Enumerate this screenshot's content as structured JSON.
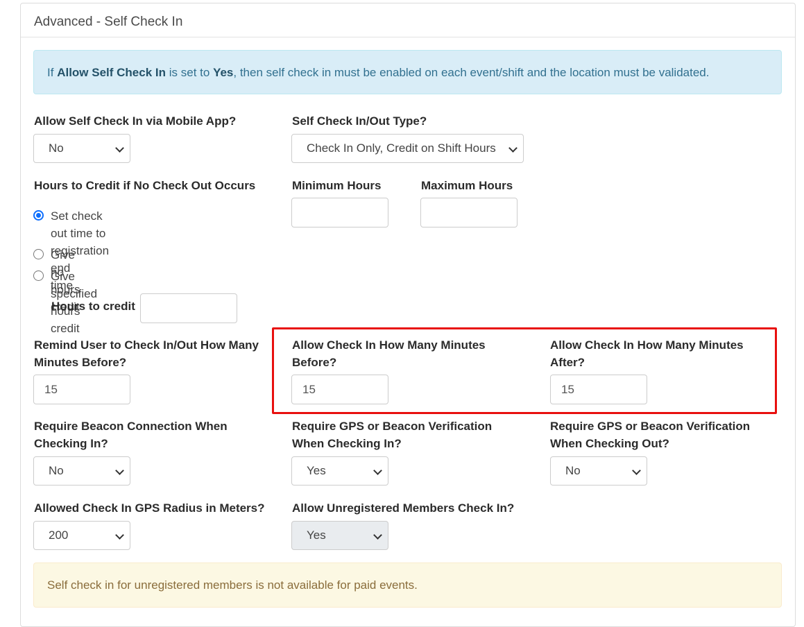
{
  "panel": {
    "title": "Advanced - Self Check In"
  },
  "info_alert": {
    "prefix": "If",
    "bold1": "Allow Self Check In",
    "mid": "is set to",
    "bold2": "Yes",
    "suffix": ", then self check in must be enabled on each event/shift and the location must be validated."
  },
  "mobile_app": {
    "label": "Allow Self Check In via Mobile App?",
    "value": "No"
  },
  "checkin_type": {
    "label": "Self Check In/Out Type?",
    "value": "Check In Only, Credit on Shift Hours"
  },
  "hours_credit": {
    "label": "Hours to Credit if No Check Out Occurs",
    "options": [
      {
        "label_line1": "Set check out time to registration end",
        "label_line2": "time",
        "checked": true
      },
      {
        "label": "Give no hours credit",
        "checked": false
      },
      {
        "label": "Give specified hours credit",
        "checked": false
      }
    ],
    "hours_to_credit_label": "Hours to credit",
    "hours_to_credit_value": ""
  },
  "min_hours": {
    "label": "Minimum Hours",
    "value": ""
  },
  "max_hours": {
    "label": "Maximum Hours",
    "value": ""
  },
  "remind": {
    "label_line1": "Remind User to Check In/Out How Many",
    "label_line2": "Minutes Before?",
    "value": "15"
  },
  "allow_before": {
    "label_line1": "Allow Check In How Many Minutes",
    "label_line2": "Before?",
    "value": "15"
  },
  "allow_after": {
    "label_line1": "Allow Check In How Many Minutes",
    "label_line2": "After?",
    "value": "15"
  },
  "beacon": {
    "label_line1": "Require Beacon Connection When",
    "label_line2": "Checking In?",
    "value": "No"
  },
  "gps_in": {
    "label_line1": "Require GPS or Beacon Verification",
    "label_line2": "When Checking In?",
    "value": "Yes"
  },
  "gps_out": {
    "label_line1": "Require GPS or Beacon Verification",
    "label_line2": "When Checking Out?",
    "value": "No"
  },
  "gps_radius": {
    "label": "Allowed Check In GPS Radius in Meters?",
    "value": "200"
  },
  "unregistered": {
    "label": "Allow Unregistered Members Check In?",
    "value": "Yes"
  },
  "warning_alert": {
    "text": "Self check in for unregistered members is not available for paid events."
  },
  "colors": {
    "highlight": "#e8100f",
    "info_bg": "#d9edf7",
    "warning_bg": "#fcf8e3",
    "radio_accent": "#0d6efd"
  }
}
